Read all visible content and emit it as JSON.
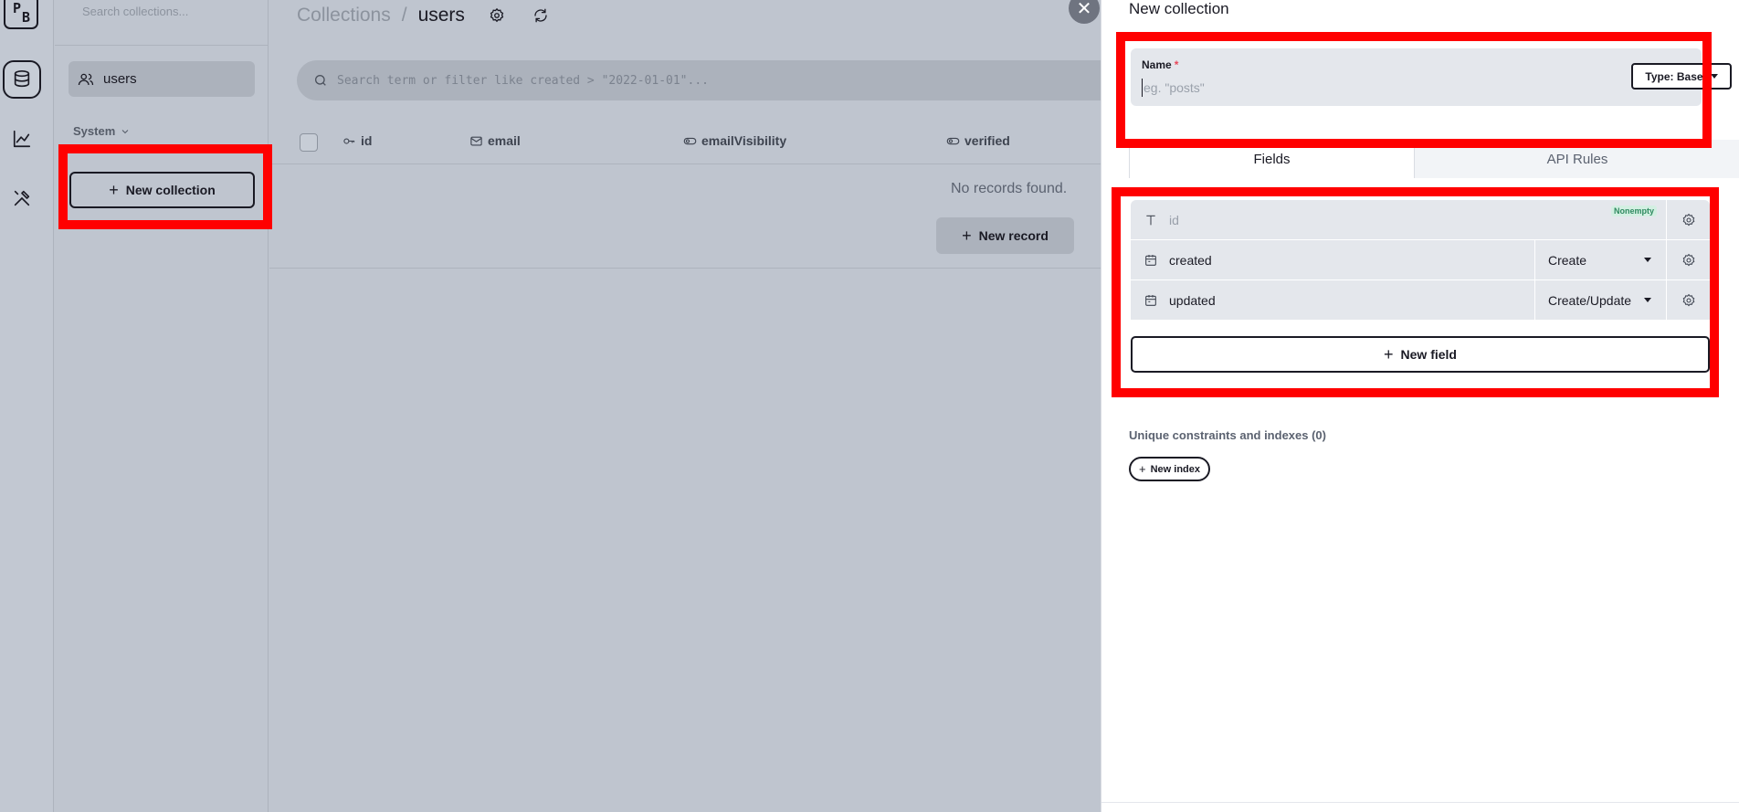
{
  "rail": {
    "logo_p": "P",
    "logo_b": "B",
    "items": [
      {
        "icon": "database-icon",
        "active": true
      },
      {
        "icon": "chart-icon",
        "active": false
      },
      {
        "icon": "tools-icon",
        "active": false
      }
    ]
  },
  "sidebar": {
    "search_placeholder": "Search collections...",
    "collections": [
      {
        "label": "users",
        "icon": "users-icon"
      }
    ],
    "system_group": "System",
    "new_collection_label": "New collection"
  },
  "main": {
    "breadcrumb_root": "Collections",
    "breadcrumb_separator": "/",
    "breadcrumb_current": "users",
    "search_placeholder": "Search term or filter like created > \"2022-01-01\"...",
    "columns": [
      {
        "label": "id",
        "icon": "key-icon"
      },
      {
        "label": "email",
        "icon": "mail-icon"
      },
      {
        "label": "emailVisibility",
        "icon": "toggle-icon"
      },
      {
        "label": "verified",
        "icon": "toggle-icon"
      }
    ],
    "empty_text": "No records found.",
    "new_record_label": "New record"
  },
  "panel": {
    "title": "New collection",
    "name_label": "Name",
    "name_required": "*",
    "name_placeholder": "eg. \"posts\"",
    "type_label": "Type: Base",
    "tabs": [
      "Fields",
      "API Rules"
    ],
    "fields": [
      {
        "name": "id",
        "icon": "text-icon",
        "option": "",
        "badge": "Nonempty"
      },
      {
        "name": "created",
        "icon": "calendar-icon",
        "option": "Create",
        "badge": ""
      },
      {
        "name": "updated",
        "icon": "calendar-icon",
        "option": "Create/Update",
        "badge": ""
      }
    ],
    "new_field_label": "New field",
    "indexes_title": "Unique constraints and indexes (0)",
    "new_index_label": "New index"
  },
  "colors": {
    "highlight": "#ff0000",
    "overlay": "#bfc5cf",
    "badge_green": "#2f8a60"
  }
}
